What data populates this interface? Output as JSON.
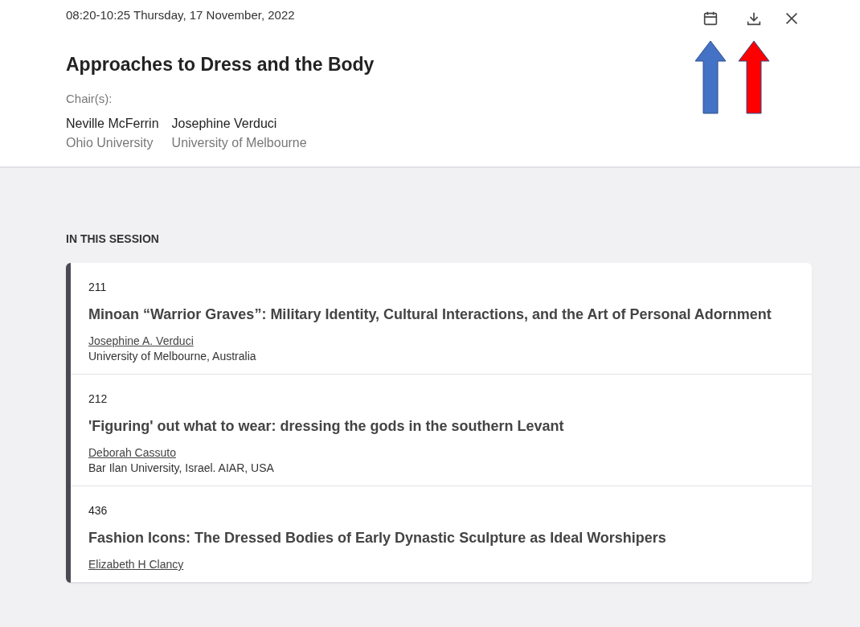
{
  "session": {
    "time": "08:20-10:25 Thursday, 17 November, 2022",
    "title": "Approaches to Dress and the Body",
    "chairs_label": "Chair(s):",
    "chairs": [
      {
        "name": "Neville McFerrin",
        "affiliation": "Ohio University"
      },
      {
        "name": "Josephine Verduci",
        "affiliation": "University of Melbourne"
      }
    ]
  },
  "annotations": [
    {
      "color": "#4472c4"
    },
    {
      "color": "#ff0000"
    }
  ],
  "section_heading": "IN THIS SESSION",
  "papers": [
    {
      "number": "211",
      "title": "Minoan “Warrior Graves”: Military Identity, Cultural Interactions, and the Art of Personal Adornment",
      "author": "Josephine A. Verduci",
      "affiliation": "University of Melbourne, Australia"
    },
    {
      "number": "212",
      "title": "'Figuring' out what to wear: dressing the gods in the southern Levant",
      "author": "Deborah Cassuto",
      "affiliation": "Bar Ilan University, Israel. AIAR, USA"
    },
    {
      "number": "436",
      "title": "Fashion Icons: The Dressed Bodies of Early Dynastic Sculpture as Ideal Worshipers",
      "author": "Elizabeth H Clancy"
    }
  ]
}
